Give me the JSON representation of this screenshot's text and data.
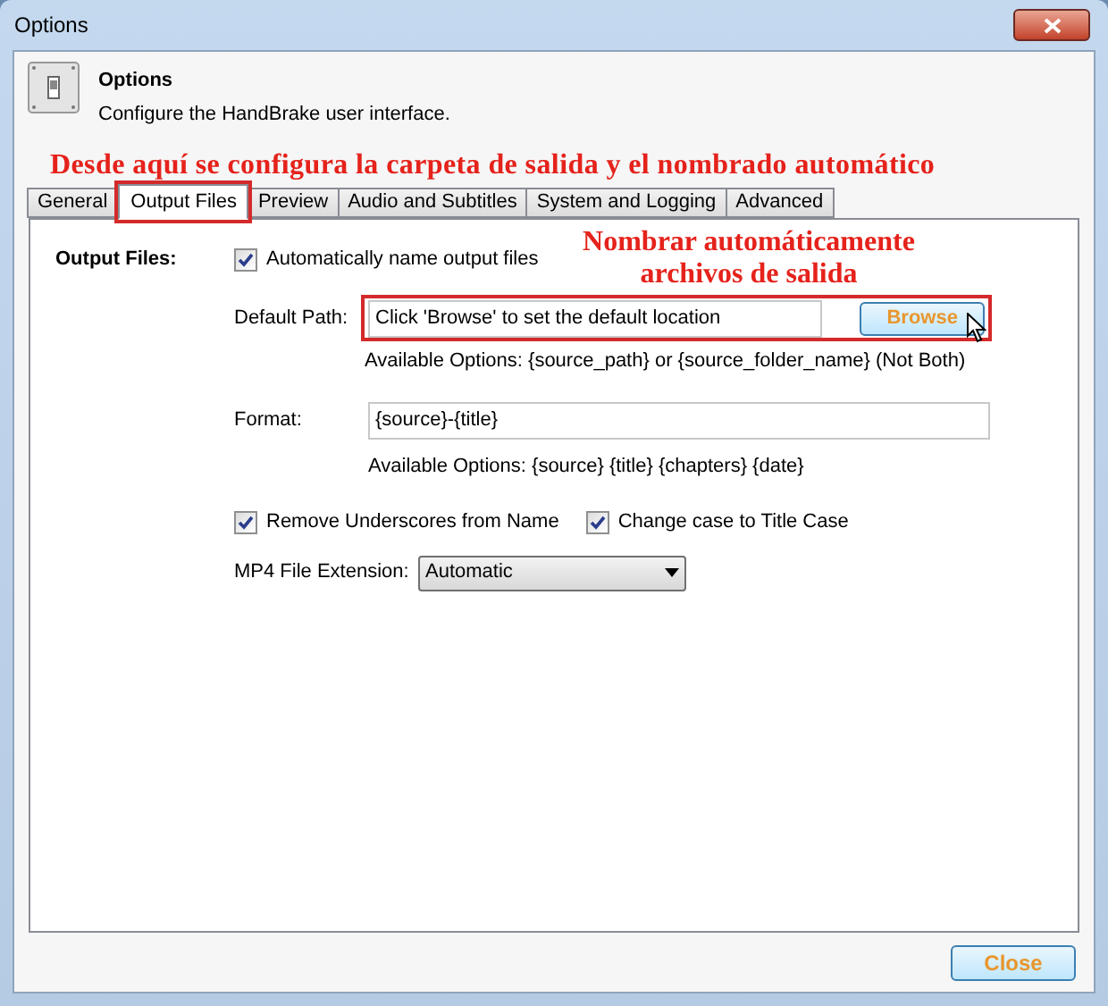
{
  "window": {
    "title": "Options"
  },
  "header": {
    "title": "Options",
    "subtitle": "Configure the HandBrake user interface."
  },
  "annotations": [
    {
      "text": "Desde aquí se configura la carpeta de salida y el nombrado automático"
    },
    {
      "text": "Nombrar automáticamente archivos de salida"
    }
  ],
  "tabs": [
    {
      "label": "General",
      "selected": false,
      "highlighted": false
    },
    {
      "label": "Output Files",
      "selected": true,
      "highlighted": true
    },
    {
      "label": "Preview",
      "selected": false,
      "highlighted": false
    },
    {
      "label": "Audio and Subtitles",
      "selected": false,
      "highlighted": false
    },
    {
      "label": "System and Logging",
      "selected": false,
      "highlighted": false
    },
    {
      "label": "Advanced",
      "selected": false,
      "highlighted": false
    }
  ],
  "section_label": "Output Files:",
  "auto_name": {
    "label": "Automatically name output files",
    "checked": true
  },
  "default_path": {
    "label": "Default Path:",
    "value": "Click 'Browse' to set the default location",
    "button": "Browse",
    "highlighted": true,
    "hint": "Available Options: {source_path} or {source_folder_name} (Not Both)"
  },
  "format": {
    "label": "Format:",
    "value": "{source}-{title}",
    "hint": "Available Options: {source} {title} {chapters} {date}"
  },
  "options": [
    {
      "label": "Remove Underscores from Name",
      "checked": true
    },
    {
      "label": "Change case to Title Case",
      "checked": true
    }
  ],
  "mp4_extension": {
    "label": "MP4 File Extension:",
    "value": "Automatic"
  },
  "buttons": [
    "Close"
  ]
}
